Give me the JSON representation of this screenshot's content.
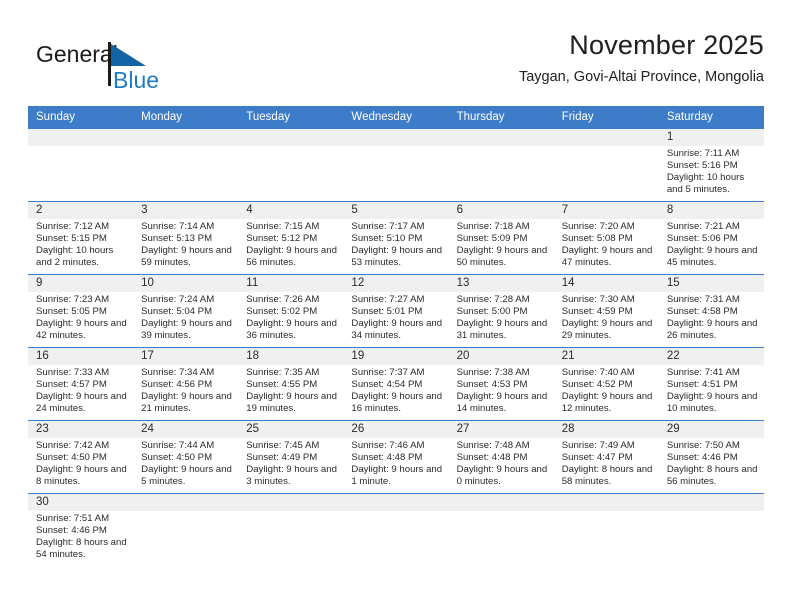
{
  "brand": {
    "name_top": "General",
    "name_bottom": "Blue",
    "color_top": "#1a1a1a",
    "color_bottom": "#1f7cc4",
    "triangle_color": "#1364a5"
  },
  "header": {
    "title": "November 2025",
    "subtitle": "Taygan, Govi-Altai Province, Mongolia"
  },
  "theme": {
    "header_bg": "#3d7cc9",
    "header_text": "#ffffff",
    "daynum_bg": "#f0f0f0",
    "grid_line": "#3d7cc9",
    "cell_bg": "#ffffff",
    "body_text": "#2b2b2b"
  },
  "weekdays": [
    "Sunday",
    "Monday",
    "Tuesday",
    "Wednesday",
    "Thursday",
    "Friday",
    "Saturday"
  ],
  "labels": {
    "sunrise": "Sunrise:",
    "sunset": "Sunset:",
    "daylight": "Daylight:"
  },
  "weeks": [
    [
      {
        "day": "",
        "empty": true
      },
      {
        "day": "",
        "empty": true
      },
      {
        "day": "",
        "empty": true
      },
      {
        "day": "",
        "empty": true
      },
      {
        "day": "",
        "empty": true
      },
      {
        "day": "",
        "empty": true
      },
      {
        "day": "1",
        "sunrise": "Sunrise: 7:11 AM",
        "sunset": "Sunset: 5:16 PM",
        "daylight": "Daylight: 10 hours and 5 minutes."
      }
    ],
    [
      {
        "day": "2",
        "sunrise": "Sunrise: 7:12 AM",
        "sunset": "Sunset: 5:15 PM",
        "daylight": "Daylight: 10 hours and 2 minutes."
      },
      {
        "day": "3",
        "sunrise": "Sunrise: 7:14 AM",
        "sunset": "Sunset: 5:13 PM",
        "daylight": "Daylight: 9 hours and 59 minutes."
      },
      {
        "day": "4",
        "sunrise": "Sunrise: 7:15 AM",
        "sunset": "Sunset: 5:12 PM",
        "daylight": "Daylight: 9 hours and 56 minutes."
      },
      {
        "day": "5",
        "sunrise": "Sunrise: 7:17 AM",
        "sunset": "Sunset: 5:10 PM",
        "daylight": "Daylight: 9 hours and 53 minutes."
      },
      {
        "day": "6",
        "sunrise": "Sunrise: 7:18 AM",
        "sunset": "Sunset: 5:09 PM",
        "daylight": "Daylight: 9 hours and 50 minutes."
      },
      {
        "day": "7",
        "sunrise": "Sunrise: 7:20 AM",
        "sunset": "Sunset: 5:08 PM",
        "daylight": "Daylight: 9 hours and 47 minutes."
      },
      {
        "day": "8",
        "sunrise": "Sunrise: 7:21 AM",
        "sunset": "Sunset: 5:06 PM",
        "daylight": "Daylight: 9 hours and 45 minutes."
      }
    ],
    [
      {
        "day": "9",
        "sunrise": "Sunrise: 7:23 AM",
        "sunset": "Sunset: 5:05 PM",
        "daylight": "Daylight: 9 hours and 42 minutes."
      },
      {
        "day": "10",
        "sunrise": "Sunrise: 7:24 AM",
        "sunset": "Sunset: 5:04 PM",
        "daylight": "Daylight: 9 hours and 39 minutes."
      },
      {
        "day": "11",
        "sunrise": "Sunrise: 7:26 AM",
        "sunset": "Sunset: 5:02 PM",
        "daylight": "Daylight: 9 hours and 36 minutes."
      },
      {
        "day": "12",
        "sunrise": "Sunrise: 7:27 AM",
        "sunset": "Sunset: 5:01 PM",
        "daylight": "Daylight: 9 hours and 34 minutes."
      },
      {
        "day": "13",
        "sunrise": "Sunrise: 7:28 AM",
        "sunset": "Sunset: 5:00 PM",
        "daylight": "Daylight: 9 hours and 31 minutes."
      },
      {
        "day": "14",
        "sunrise": "Sunrise: 7:30 AM",
        "sunset": "Sunset: 4:59 PM",
        "daylight": "Daylight: 9 hours and 29 minutes."
      },
      {
        "day": "15",
        "sunrise": "Sunrise: 7:31 AM",
        "sunset": "Sunset: 4:58 PM",
        "daylight": "Daylight: 9 hours and 26 minutes."
      }
    ],
    [
      {
        "day": "16",
        "sunrise": "Sunrise: 7:33 AM",
        "sunset": "Sunset: 4:57 PM",
        "daylight": "Daylight: 9 hours and 24 minutes."
      },
      {
        "day": "17",
        "sunrise": "Sunrise: 7:34 AM",
        "sunset": "Sunset: 4:56 PM",
        "daylight": "Daylight: 9 hours and 21 minutes."
      },
      {
        "day": "18",
        "sunrise": "Sunrise: 7:35 AM",
        "sunset": "Sunset: 4:55 PM",
        "daylight": "Daylight: 9 hours and 19 minutes."
      },
      {
        "day": "19",
        "sunrise": "Sunrise: 7:37 AM",
        "sunset": "Sunset: 4:54 PM",
        "daylight": "Daylight: 9 hours and 16 minutes."
      },
      {
        "day": "20",
        "sunrise": "Sunrise: 7:38 AM",
        "sunset": "Sunset: 4:53 PM",
        "daylight": "Daylight: 9 hours and 14 minutes."
      },
      {
        "day": "21",
        "sunrise": "Sunrise: 7:40 AM",
        "sunset": "Sunset: 4:52 PM",
        "daylight": "Daylight: 9 hours and 12 minutes."
      },
      {
        "day": "22",
        "sunrise": "Sunrise: 7:41 AM",
        "sunset": "Sunset: 4:51 PM",
        "daylight": "Daylight: 9 hours and 10 minutes."
      }
    ],
    [
      {
        "day": "23",
        "sunrise": "Sunrise: 7:42 AM",
        "sunset": "Sunset: 4:50 PM",
        "daylight": "Daylight: 9 hours and 8 minutes."
      },
      {
        "day": "24",
        "sunrise": "Sunrise: 7:44 AM",
        "sunset": "Sunset: 4:50 PM",
        "daylight": "Daylight: 9 hours and 5 minutes."
      },
      {
        "day": "25",
        "sunrise": "Sunrise: 7:45 AM",
        "sunset": "Sunset: 4:49 PM",
        "daylight": "Daylight: 9 hours and 3 minutes."
      },
      {
        "day": "26",
        "sunrise": "Sunrise: 7:46 AM",
        "sunset": "Sunset: 4:48 PM",
        "daylight": "Daylight: 9 hours and 1 minute."
      },
      {
        "day": "27",
        "sunrise": "Sunrise: 7:48 AM",
        "sunset": "Sunset: 4:48 PM",
        "daylight": "Daylight: 9 hours and 0 minutes."
      },
      {
        "day": "28",
        "sunrise": "Sunrise: 7:49 AM",
        "sunset": "Sunset: 4:47 PM",
        "daylight": "Daylight: 8 hours and 58 minutes."
      },
      {
        "day": "29",
        "sunrise": "Sunrise: 7:50 AM",
        "sunset": "Sunset: 4:46 PM",
        "daylight": "Daylight: 8 hours and 56 minutes."
      }
    ],
    [
      {
        "day": "30",
        "sunrise": "Sunrise: 7:51 AM",
        "sunset": "Sunset: 4:46 PM",
        "daylight": "Daylight: 8 hours and 54 minutes."
      },
      {
        "day": "",
        "empty": true
      },
      {
        "day": "",
        "empty": true
      },
      {
        "day": "",
        "empty": true
      },
      {
        "day": "",
        "empty": true
      },
      {
        "day": "",
        "empty": true
      },
      {
        "day": "",
        "empty": true
      }
    ]
  ]
}
